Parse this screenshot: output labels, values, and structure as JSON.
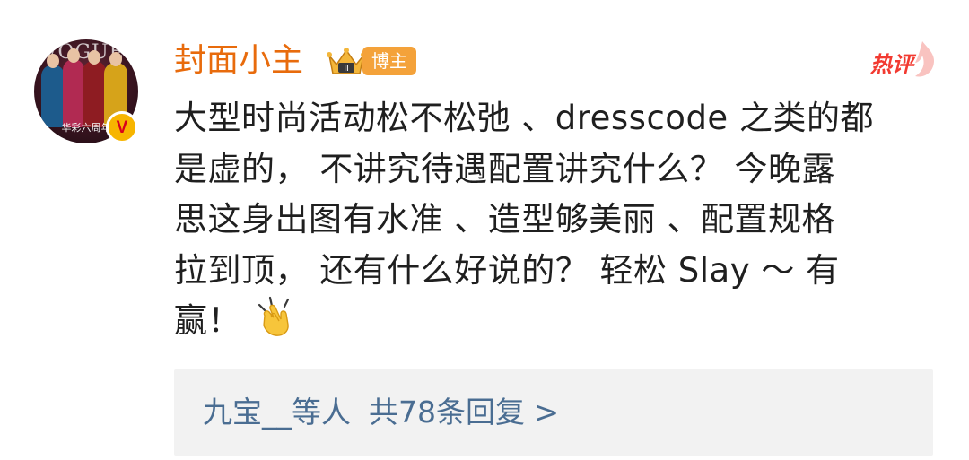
{
  "comment": {
    "username": "封面小主",
    "role_badge": "博主",
    "verified_badge": "V",
    "avatar": {
      "magazine_title": "VOGUE",
      "magazine_subtitle": "华彩六周年"
    },
    "hot_tag": "热评",
    "body_lines": [
      "大型时尚活动松不松弛 、dresscode 之类的都",
      "是虚的， 不讲究待遇配置讲究什么？ 今晚露",
      "思这身出图有水准 、造型够美丽 、配置规格",
      "拉到顶， 还有什么好说的？ 轻松 Slay ～ 有",
      "赢！"
    ],
    "emoji": "clapping-hands",
    "replies": {
      "names": "九宝__等人",
      "count_text": "共78条回复 >"
    }
  },
  "colors": {
    "username": "#e86b0c",
    "role_badge_bg": "#f4a23a",
    "hot_tag": "#f23a31",
    "reply_link": "#4a6d92",
    "reply_bg": "#f2f2f2",
    "verified_bg": "#f7b500",
    "verified_fg": "#d9001b"
  },
  "icons": [
    "crown-icon",
    "hot-fire-icon",
    "clapping-hands-emoji",
    "verified-icon"
  ]
}
